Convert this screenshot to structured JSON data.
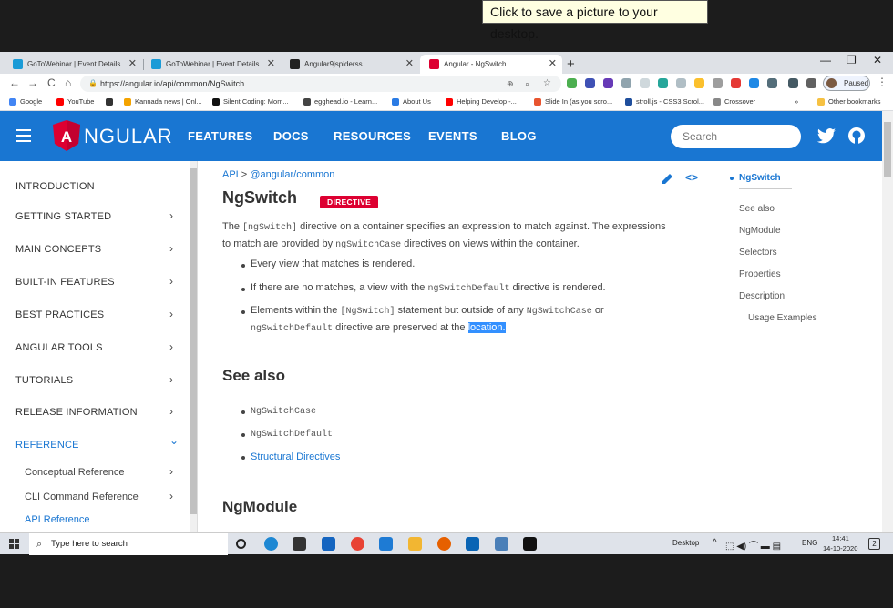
{
  "tooltip": "Click to save a picture to your desktop.",
  "browser": {
    "tabs": [
      {
        "title": "GoToWebinar | Event Details",
        "icon_color": "#1a9bd7"
      },
      {
        "title": "GoToWebinar | Event Details",
        "icon_color": "#1a9bd7"
      },
      {
        "title": "Angular9jspiderss",
        "icon_color": "#222222"
      },
      {
        "title": "Angular - NgSwitch",
        "icon_color": "#dd0031"
      }
    ],
    "new_tab": "+",
    "window_controls": {
      "minimize": "—",
      "maximize": "❐",
      "close": "✕"
    },
    "nav": {
      "back": "←",
      "forward": "→",
      "reload": "C",
      "home": "⌂"
    },
    "url": "https://angular.io/api/common/NgSwitch",
    "profile_status": "Paused",
    "menu": "⋮",
    "bookmarks": [
      {
        "label": "Google",
        "color": "#4285f4"
      },
      {
        "label": "YouTube",
        "color": "#ff0000"
      },
      {
        "label": "",
        "color": "#333333"
      },
      {
        "label": "Kannada news | Onl...",
        "color": "#f4a300"
      },
      {
        "label": "Silent Coding: Mom...",
        "color": "#111111"
      },
      {
        "label": "egghead.io - Learn...",
        "color": "#444444"
      },
      {
        "label": "About Us",
        "color": "#2a7be4"
      },
      {
        "label": "Helping Develop -...",
        "color": "#ff0000"
      },
      {
        "label": "Slide In (as you scro...",
        "color": "#e8542f"
      },
      {
        "label": "stroll.js - CSS3 Scrol...",
        "color": "#1f4e9c"
      },
      {
        "label": "Crossover",
        "color": "#888888"
      }
    ],
    "bookmarks_more": "»",
    "other_bookmarks": "Other bookmarks"
  },
  "angular": {
    "brand": "NGULAR",
    "brand_letter": "A",
    "nav_links": [
      "FEATURES",
      "DOCS",
      "RESOURCES",
      "EVENTS",
      "BLOG"
    ],
    "search_placeholder": "Search",
    "sidebar": [
      {
        "label": "INTRODUCTION",
        "chevron": ""
      },
      {
        "label": "GETTING STARTED",
        "chevron": "›"
      },
      {
        "label": "MAIN CONCEPTS",
        "chevron": "›"
      },
      {
        "label": "BUILT-IN FEATURES",
        "chevron": "›"
      },
      {
        "label": "BEST PRACTICES",
        "chevron": "›"
      },
      {
        "label": "ANGULAR TOOLS",
        "chevron": "›"
      },
      {
        "label": "TUTORIALS",
        "chevron": "›"
      },
      {
        "label": "RELEASE INFORMATION",
        "chevron": "›"
      },
      {
        "label": "REFERENCE",
        "chevron": "⌄"
      }
    ],
    "sidebar_sub": [
      {
        "label": "Conceptual Reference",
        "chevron": "›"
      },
      {
        "label": "CLI Command Reference",
        "chevron": "›"
      },
      {
        "label": "API Reference",
        "chevron": ""
      }
    ],
    "breadcrumb": {
      "root": "API",
      "sep": ">",
      "pkg": "@angular/common"
    },
    "title": "NgSwitch",
    "badge": "DIRECTIVE",
    "intro": {
      "l1a": "The ",
      "l1code": "[ngSwitch]",
      "l1b": " directive on a container specifies an expression to match against. The expressions",
      "l2a": "to match are provided by ",
      "l2code": "ngSwitchCase",
      "l2b": " directives on views within the container."
    },
    "bullets": {
      "b1": "Every view that matches is rendered.",
      "b2a": "If there are no matches, a view with the ",
      "b2code": "ngSwitchDefault",
      "b2b": " directive is rendered.",
      "b3a": "Elements within the ",
      "b3code": "[NgSwitch]",
      "b3b": " statement but outside of any ",
      "b3code2": "NgSwitchCase",
      "b3c": " or",
      "b3code3": "ngSwitchDefault",
      "b3d": " directive are preserved at the ",
      "b3sel": "location."
    },
    "see_also_heading": "See also",
    "see_also": [
      "NgSwitchCase",
      "NgSwitchDefault",
      "Structural Directives"
    ],
    "ngmodule_heading": "NgModule",
    "toc": [
      "NgSwitch",
      "See also",
      "NgModule",
      "Selectors",
      "Properties",
      "Description",
      "Usage Examples"
    ]
  },
  "taskbar": {
    "search_placeholder": "Type here to search",
    "desktop": "Desktop",
    "language": "ENG",
    "time": "14:41",
    "date": "14-10-2020",
    "notifications": "2",
    "apps": [
      {
        "name": "task-view",
        "color": "#222222"
      },
      {
        "name": "edge",
        "color": "#1e88d3"
      },
      {
        "name": "store",
        "color": "#333333"
      },
      {
        "name": "mail",
        "color": "#1565c0"
      },
      {
        "name": "chrome",
        "color": "#e84335"
      },
      {
        "name": "vscode",
        "color": "#1e7bd4"
      },
      {
        "name": "file-explorer",
        "color": "#f2b632"
      },
      {
        "name": "firefox",
        "color": "#e66000"
      },
      {
        "name": "media",
        "color": "#0a64b4"
      },
      {
        "name": "settings-app",
        "color": "#4a7fb8"
      },
      {
        "name": "terminal",
        "color": "#111111"
      }
    ]
  }
}
